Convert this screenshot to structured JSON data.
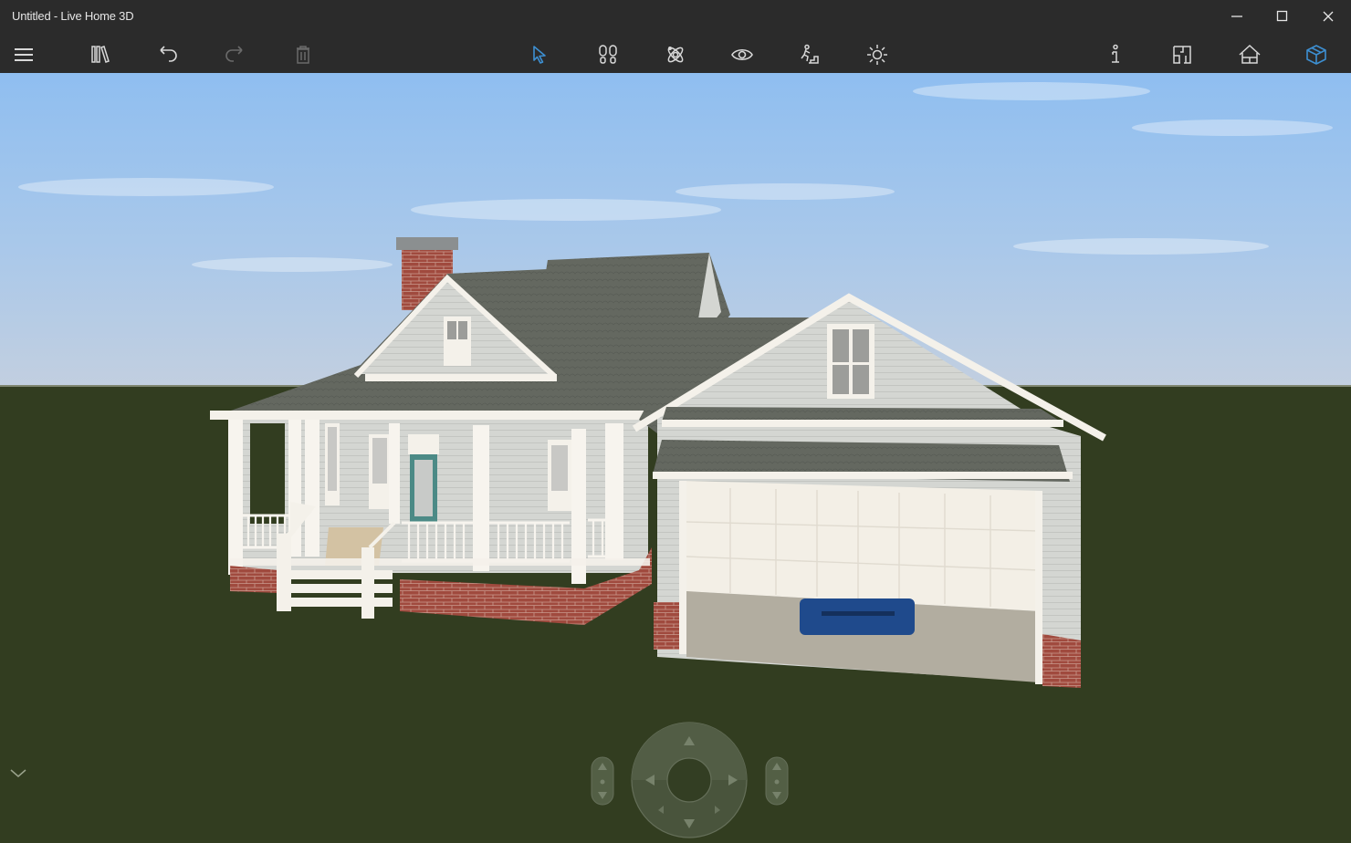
{
  "window": {
    "title": "Untitled - Live Home 3D",
    "controls": [
      {
        "name": "minimize",
        "icon": "minimize-icon",
        "glyph": "—"
      },
      {
        "name": "maximize",
        "icon": "maximize-icon",
        "glyph": "☐"
      },
      {
        "name": "close",
        "icon": "close-icon",
        "glyph": "✕"
      }
    ]
  },
  "toolbar": {
    "left": [
      {
        "name": "menu",
        "icon": "hamburger-menu-icon",
        "enabled": true
      },
      {
        "name": "library",
        "icon": "library-icon",
        "enabled": true
      },
      {
        "name": "undo",
        "icon": "undo-icon",
        "enabled": true
      },
      {
        "name": "redo",
        "icon": "redo-icon",
        "enabled": false
      },
      {
        "name": "delete",
        "icon": "trash-icon",
        "enabled": false
      }
    ],
    "center": [
      {
        "name": "select",
        "icon": "cursor-arrow-icon",
        "active": true
      },
      {
        "name": "walk",
        "icon": "footprints-icon",
        "active": false
      },
      {
        "name": "orbit",
        "icon": "orbit-icon",
        "active": false
      },
      {
        "name": "look",
        "icon": "eye-icon",
        "active": false
      },
      {
        "name": "walk-stairs",
        "icon": "climber-icon",
        "active": false
      },
      {
        "name": "lighting",
        "icon": "sun-icon",
        "active": false
      }
    ],
    "right": [
      {
        "name": "info",
        "icon": "info-icon",
        "active": false
      },
      {
        "name": "2d-plan",
        "icon": "floor-plan-icon",
        "active": false
      },
      {
        "name": "elevation",
        "icon": "house-elevation-icon",
        "active": false
      },
      {
        "name": "3d-view",
        "icon": "3d-box-icon",
        "active": true
      }
    ],
    "accent_color": "#3d8fd1",
    "icon_color": "#d8d8d8",
    "disabled_color": "#6a6a6a"
  },
  "scene": {
    "sky_top": "#8fc0f0",
    "sky_horizon": "#c2cfe0",
    "ground": "#323d20",
    "siding": "#d4d6d2",
    "roof": "#63675f",
    "trim": "#f4f1ea",
    "brick": "#a04a3e",
    "door": "#4c8a86",
    "car": "#1f4a8c",
    "garage_floor": "#b2ada0"
  },
  "navigation": {
    "collapse_icon": "chevron-down-icon",
    "joystick_arrows": [
      "up",
      "down",
      "left",
      "right",
      "down-left",
      "down-right"
    ],
    "left_slider": "elevation-slider",
    "right_slider": "pitch-slider"
  }
}
